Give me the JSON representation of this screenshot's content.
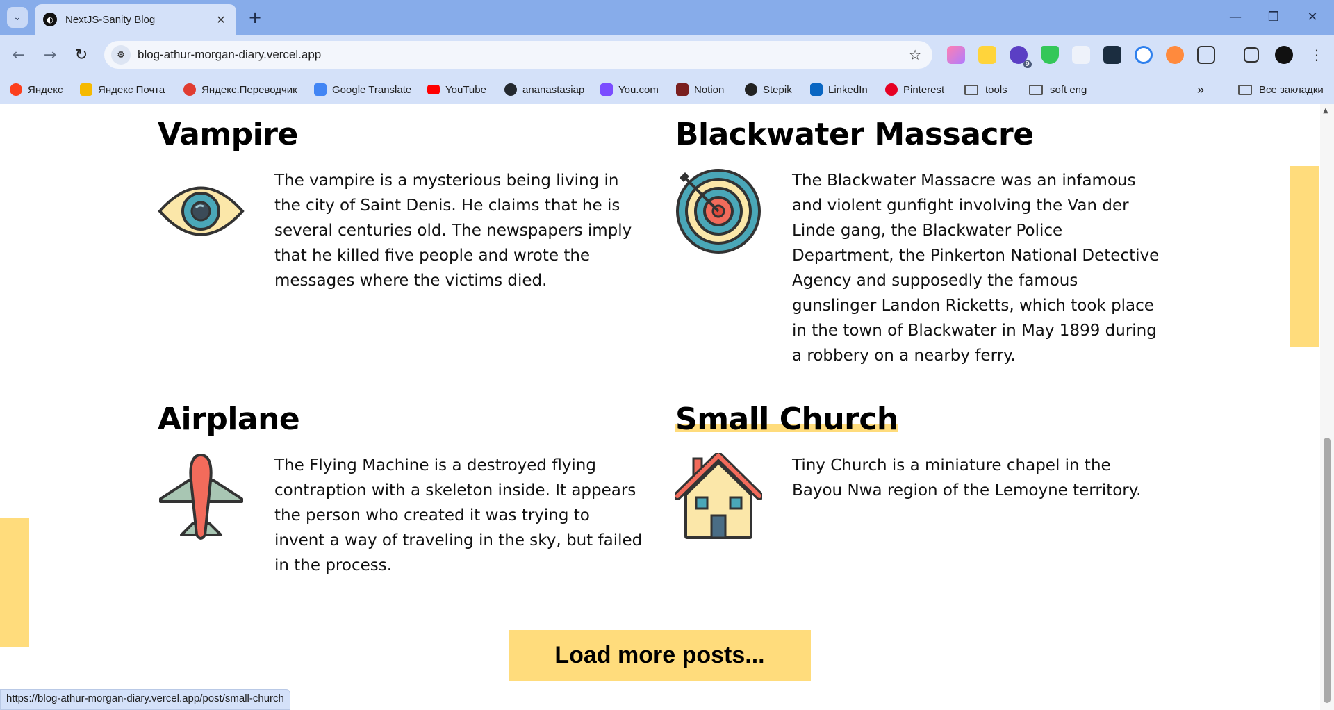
{
  "browser": {
    "tab_title": "NextJS-Sanity Blog",
    "url": "blog-athur-morgan-diary.vercel.app",
    "status_url": "https://blog-athur-morgan-diary.vercel.app/post/small-church",
    "extension_badge": "9"
  },
  "bookmarks": [
    {
      "label": "Яндекс",
      "icon": "yandex-icon",
      "color": "#fc3f1d"
    },
    {
      "label": "Яндекс Почта",
      "icon": "mail-icon",
      "color": "#f5b900"
    },
    {
      "label": "Яндекс.Переводчик",
      "icon": "translate-icon",
      "color": "#e03c31"
    },
    {
      "label": "Google Translate",
      "icon": "google-translate-icon",
      "color": "#4285f4"
    },
    {
      "label": "YouTube",
      "icon": "youtube-icon",
      "color": "#ff0000"
    },
    {
      "label": "ananastasiap",
      "icon": "github-icon",
      "color": "#24292f"
    },
    {
      "label": "You.com",
      "icon": "you-icon",
      "color": "#7b4dff"
    },
    {
      "label": "Notion",
      "icon": "notion-icon",
      "color": "#7a1f1f"
    },
    {
      "label": "Stepik",
      "icon": "stepik-icon",
      "color": "#222222"
    },
    {
      "label": "LinkedIn",
      "icon": "linkedin-icon",
      "color": "#0a66c2"
    },
    {
      "label": "Pinterest",
      "icon": "pinterest-icon",
      "color": "#e60023"
    },
    {
      "label": "tools",
      "icon": "folder-icon",
      "color": "#555555"
    },
    {
      "label": "soft eng",
      "icon": "folder-icon",
      "color": "#555555"
    }
  ],
  "all_bookmarks": "Все закладки",
  "posts": [
    {
      "title": "Vampire",
      "icon": "eye-icon",
      "text": "The vampire is a mysterious being living in the city of Saint Denis. He claims that he is several centuries old. The newspapers imply that he killed five people and wrote the messages where the victims died."
    },
    {
      "title": "Blackwater Massacre",
      "icon": "target-icon",
      "text": "The Blackwater Massacre was an infamous and violent gunfight involving the Van der Linde gang, the Blackwater Police Department, the Pinkerton National Detective Agency and supposedly the famous gunslinger Landon Ricketts, which took place in the town of Blackwater in May 1899 during a robbery on a nearby ferry."
    },
    {
      "title": "Airplane",
      "icon": "airplane-icon",
      "text": "The Flying Machine is a destroyed flying contraption with a skeleton inside. It appears the person who created it was trying to invent a way of traveling in the sky, but failed in the process."
    },
    {
      "title": "Small Church",
      "icon": "house-icon",
      "text": "Tiny Church is a miniature chapel in the Bayou Nwa region of the Lemoyne territory."
    }
  ],
  "load_more_label": "Load more posts...",
  "colors": {
    "accent_yellow": "#ffdc7c",
    "chrome_blue": "#87acea",
    "toolbar_blue": "#d4e1f9"
  }
}
